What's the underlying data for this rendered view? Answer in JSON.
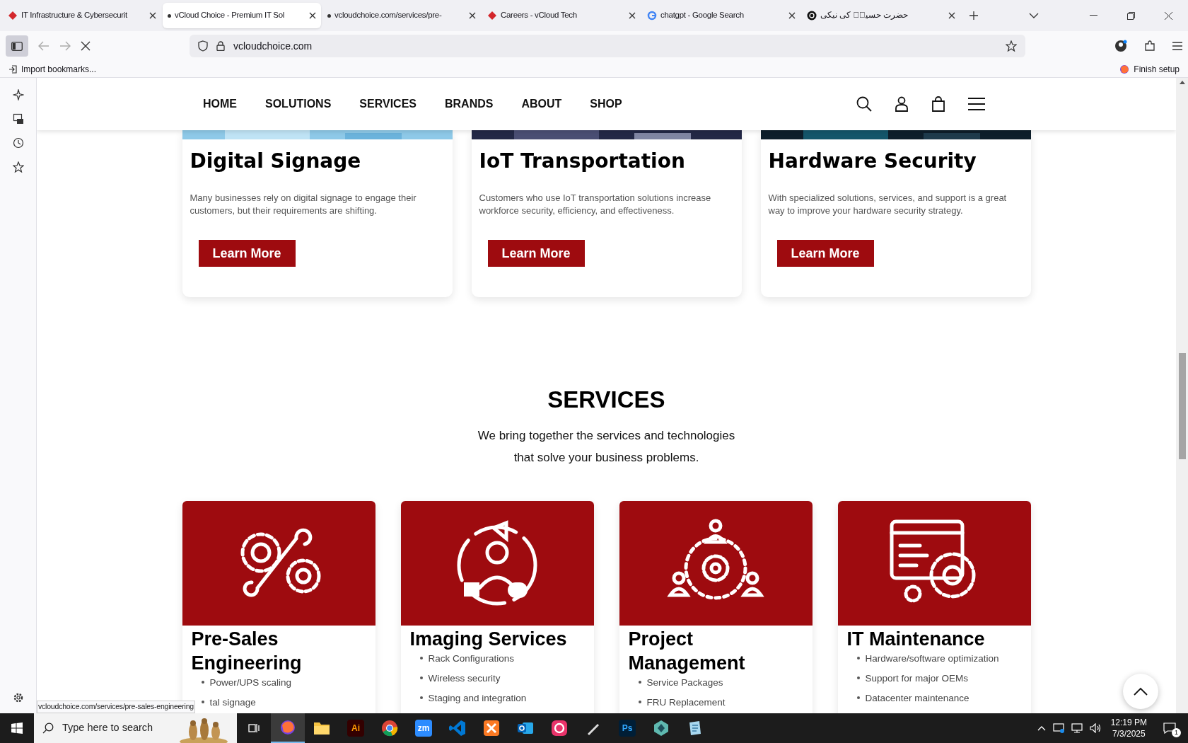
{
  "browser": {
    "tabs": [
      {
        "title": "IT Infrastructure & Cybersecurit",
        "kind": "brand",
        "selected": false
      },
      {
        "title": "vCloud Choice - Premium IT Sol",
        "kind": "dot",
        "selected": true
      },
      {
        "title": "vcloudchoice.com/services/pre-",
        "kind": "dot",
        "selected": false
      },
      {
        "title": "Careers - vCloud Tech",
        "kind": "brand",
        "selected": false
      },
      {
        "title": "chatgpt - Google Search",
        "kind": "google",
        "selected": false
      },
      {
        "title": "حضرت حسینؓ کی نیکی",
        "kind": "ai",
        "selected": false
      }
    ],
    "url": "vcloudchoice.com",
    "bookmark": "Import bookmarks...",
    "finish_setup": "Finish setup",
    "status_link": "vcloudchoice.com/services/pre-sales-engineering"
  },
  "nav": [
    "HOME",
    "SOLUTIONS",
    "SERVICES",
    "BRANDS",
    "ABOUT",
    "SHOP"
  ],
  "solutions": [
    {
      "title": "Digital Signage",
      "text": "Many businesses rely on digital signage to engage their customers, but their requirements are shifting.",
      "button": "Learn More"
    },
    {
      "title": "IoT Transportation",
      "text": "Customers who use IoT transportation solutions increase workforce security, efficiency, and effectiveness.",
      "button": "Learn More"
    },
    {
      "title": "Hardware Security",
      "text": "With specialized solutions, services, and support is a great way to improve your hardware security strategy.",
      "button": "Learn More"
    }
  ],
  "services": {
    "heading": "SERVICES",
    "intro": [
      "We bring together the services and technologies",
      "that solve your business problems."
    ],
    "cards": [
      {
        "kind": "tools",
        "title": "Pre-Sales Engineering",
        "items": [
          "Power/UPS scaling",
          "tal signage"
        ]
      },
      {
        "kind": "person",
        "title": "Imaging Services",
        "items": [
          "Rack Configurations",
          "Wireless security",
          "Staging and integration"
        ]
      },
      {
        "kind": "team",
        "title": "Project Management",
        "items": [
          "Service Packages",
          "FRU Replacement"
        ]
      },
      {
        "kind": "monitor",
        "title": "IT Maintenance",
        "items": [
          "Hardware/software optimization",
          "Support for major OEMs",
          "Datacenter maintenance"
        ]
      }
    ]
  },
  "taskbar": {
    "search": "Type here to search",
    "apps": [
      {
        "kind": "firefox"
      },
      {
        "kind": "folder"
      },
      {
        "kind": "tile",
        "label": {
          "text": "Ai",
          "color": "#ff9a00"
        },
        "color": "#330000"
      },
      {
        "kind": "chrome"
      },
      {
        "kind": "tile",
        "label": {
          "text": "zm",
          "color": "#ffffff"
        },
        "color": "#2d8cff"
      },
      {
        "kind": "vscode"
      },
      {
        "kind": "xampp"
      },
      {
        "kind": "outlook"
      },
      {
        "kind": "cloud"
      },
      {
        "kind": "pen"
      },
      {
        "kind": "tile",
        "label": {
          "text": "Ps",
          "color": "#31a8ff"
        },
        "color": "#001e36"
      },
      {
        "kind": "gem"
      },
      {
        "kind": "notepad"
      }
    ],
    "time": "12:19 PM",
    "date": "7/3/2025",
    "notifications": "1"
  }
}
